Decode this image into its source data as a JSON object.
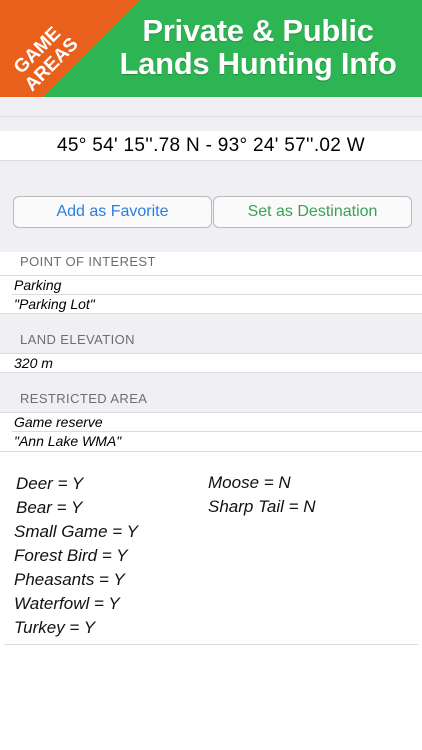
{
  "banner": {
    "title_line1": "Private & Public",
    "title_line2": "Lands Hunting Info",
    "background_color": "#2db553",
    "corner_line1": "GAME",
    "corner_line2": "AREAS",
    "corner_color": "#e8601c"
  },
  "location": {
    "coordinates": "45° 54' 15''.78 N  -  93° 24' 57''.02 W"
  },
  "actions": {
    "favorite_label": "Add as Favorite",
    "destination_label": "Set as Destination"
  },
  "point_of_interest": {
    "header": "POINT OF INTEREST",
    "type": "Parking",
    "name": "\"Parking Lot\""
  },
  "land_elevation": {
    "header": "LAND ELEVATION",
    "value": "320 m"
  },
  "restricted_area": {
    "header": "RESTRICTED AREA",
    "type": "Game reserve",
    "name": "\"Ann Lake WMA\""
  },
  "hunting": {
    "left": [
      "Deer = Y",
      "Bear = Y",
      "Small Game = Y",
      "Forest Bird = Y",
      "Pheasants = Y",
      "Waterfowl = Y",
      "Turkey = Y"
    ],
    "right": [
      "Moose = N",
      "Sharp Tail = N"
    ]
  }
}
